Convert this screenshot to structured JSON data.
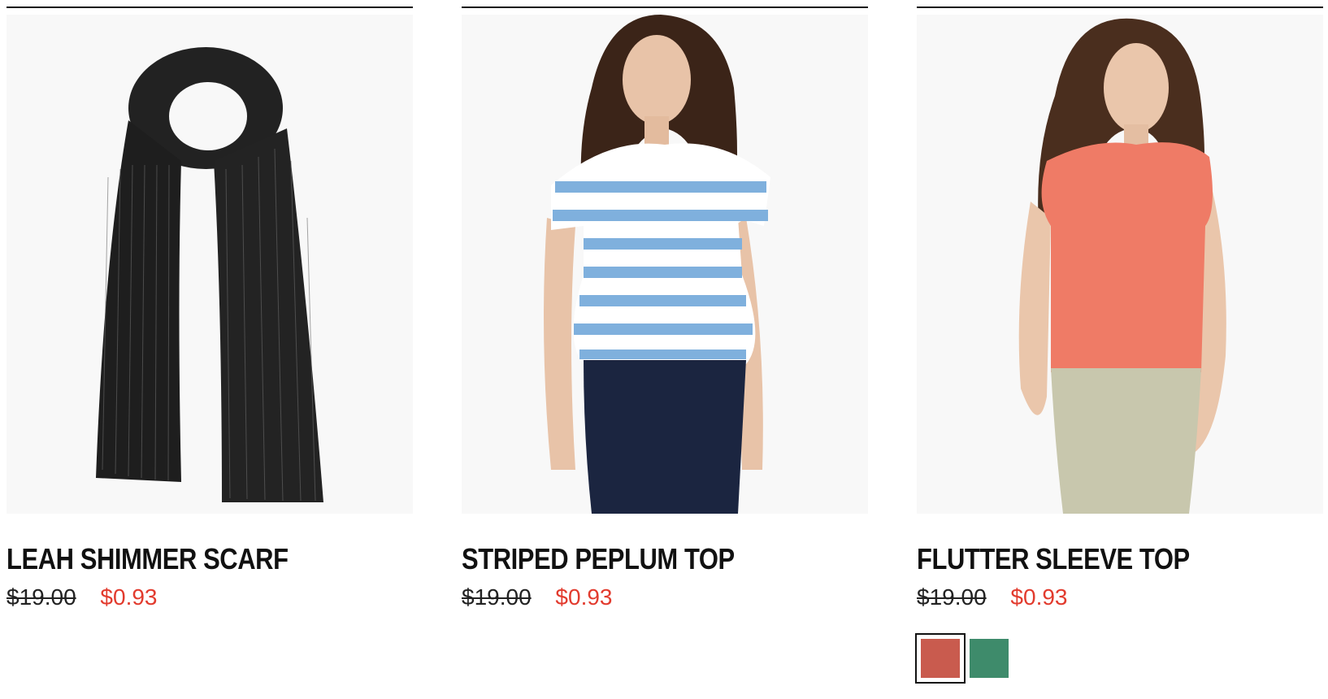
{
  "products": [
    {
      "image_alt": "leah shimmer scarf",
      "name": "LEAH SHIMMER SCARF",
      "original_price": "$19.00",
      "sale_price": "$0.93"
    },
    {
      "image_alt": "striped peplum top",
      "name": "STRIPED PEPLUM TOP",
      "original_price": "$19.00",
      "sale_price": "$0.93"
    },
    {
      "image_alt": "flutter sleeve top",
      "name": "FLUTTER SLEEVE TOP",
      "original_price": "$19.00",
      "sale_price": "$0.93",
      "swatches": [
        {
          "color": "#c95b4e",
          "selected": true
        },
        {
          "color": "#3e8b6b",
          "selected": false
        }
      ]
    }
  ],
  "colors": {
    "sale_price": "#e23b2e",
    "divider": "#111111"
  }
}
